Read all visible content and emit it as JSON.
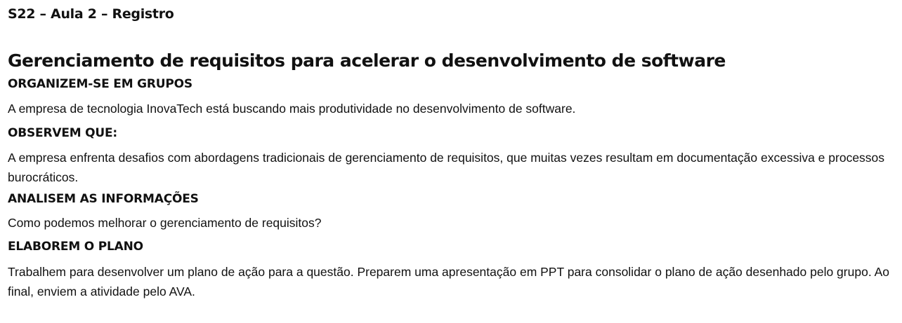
{
  "breadcrumb": "S22 – Aula 2 – Registro",
  "title": "Gerenciamento de requisitos para acelerar o desenvolvimento de software",
  "sections": [
    {
      "heading": "ORGANIZEM-SE EM GRUPOS",
      "text": "A empresa de tecnologia InovaTech está buscando mais produtividade no desenvolvimento de software."
    },
    {
      "heading": "OBSERVEM QUE:",
      "text": "A empresa enfrenta desafios com abordagens tradicionais de gerenciamento de requisitos, que muitas vezes resultam em documentação excessiva e processos burocráticos."
    },
    {
      "heading": "ANALISEM AS INFORMAÇÕES",
      "text": "Como podemos melhorar o gerenciamento de requisitos?"
    },
    {
      "heading": "ELABOREM O PLANO",
      "text": "Trabalhem para desenvolver um plano de ação para a questão. Preparem uma apresentação em PPT para consolidar o plano de ação desenhado pelo grupo. Ao final, enviem a atividade pelo AVA."
    }
  ]
}
